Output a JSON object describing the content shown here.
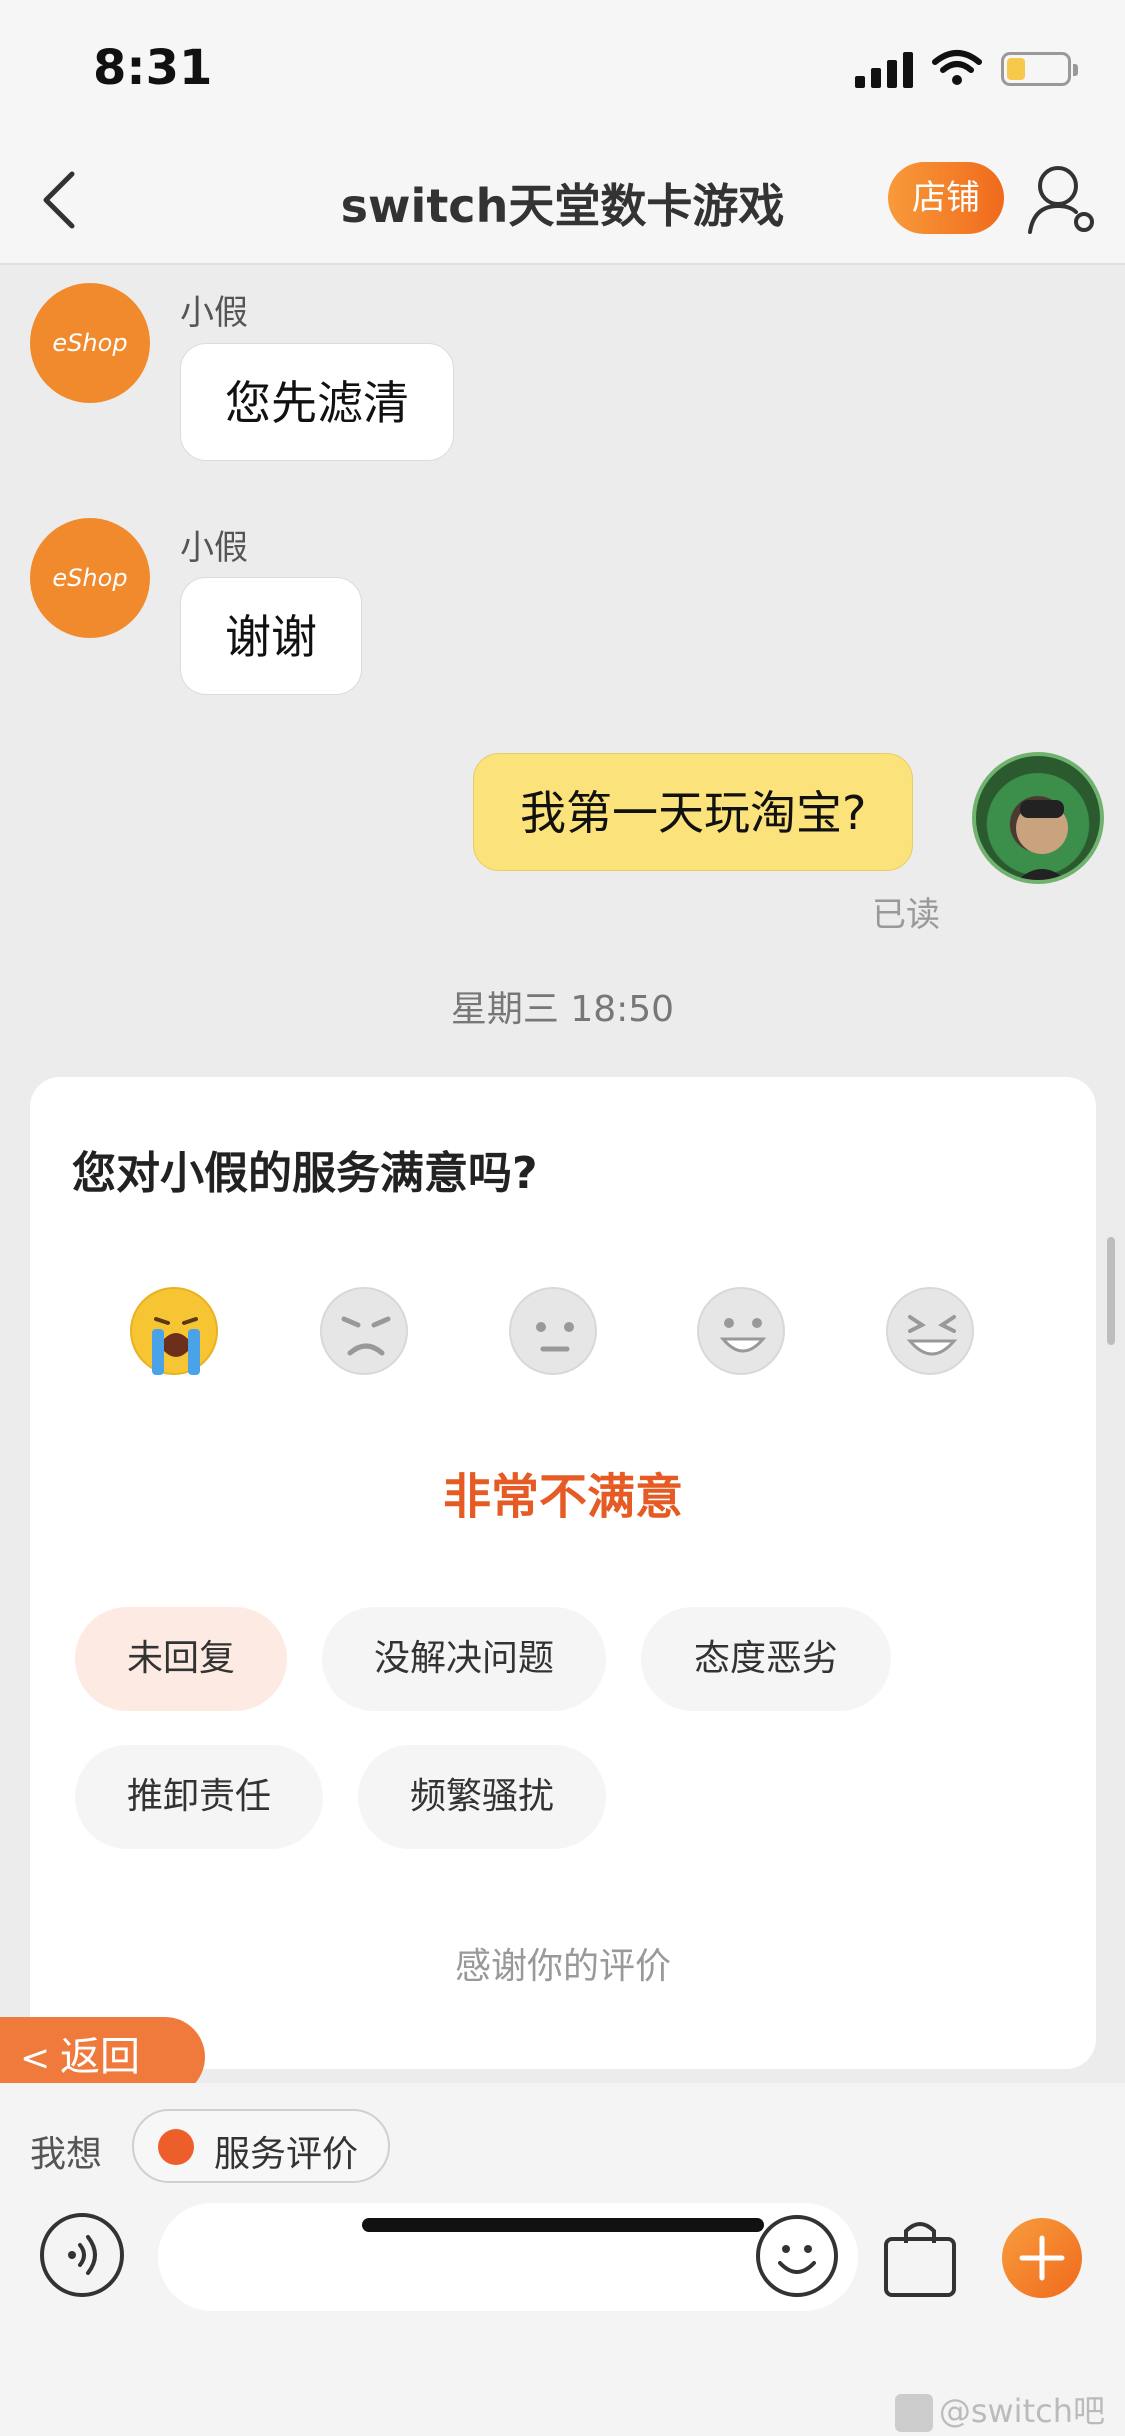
{
  "status_bar": {
    "time": "8:31"
  },
  "nav": {
    "title": "switch天堂数卡游戏",
    "shop_label": "店铺"
  },
  "messages": [
    {
      "sender": "小假",
      "avatar_text": "eShop",
      "text": "您先滤清"
    },
    {
      "sender": "小假",
      "avatar_text": "eShop",
      "text": "谢谢"
    },
    {
      "text": "我第一天玩淘宝?",
      "status": "已读"
    }
  ],
  "timestamp": "星期三 18:50",
  "survey": {
    "question": "您对小假的服务满意吗?",
    "selected_rating_label": "非常不满意",
    "tags": [
      "未回复",
      "没解决问题",
      "态度恶劣",
      "推卸责任",
      "频繁骚扰"
    ],
    "thanks": "感谢你的评价"
  },
  "return_label": "返回",
  "quick_actions": {
    "label": "我想",
    "chip": "服务评价"
  },
  "watermark": "@switch吧"
}
